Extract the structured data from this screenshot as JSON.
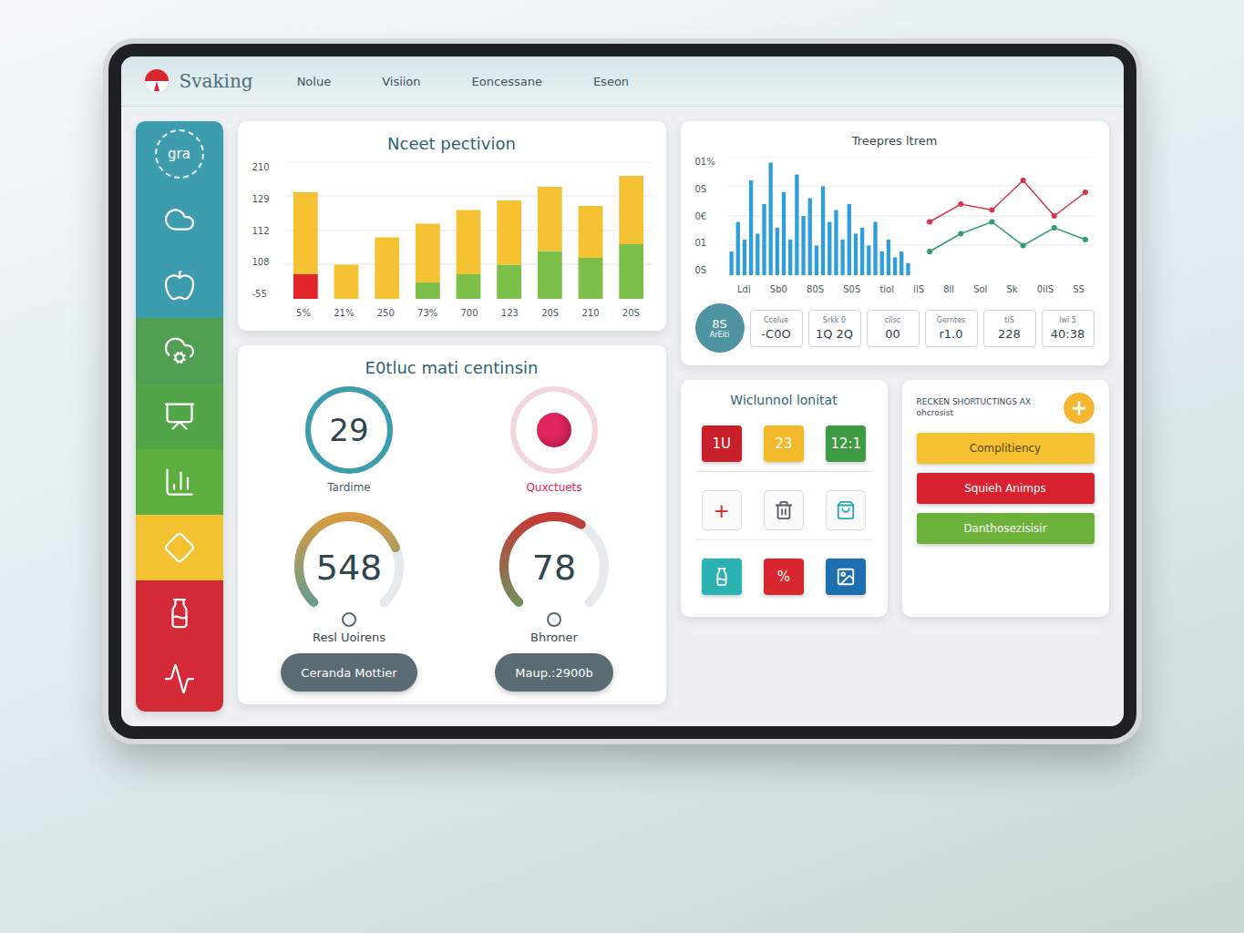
{
  "header": {
    "logo": "Svaking",
    "nav": [
      "Nolue",
      "Visiion",
      "Eoncessane",
      "Eseon"
    ]
  },
  "sidebar": {
    "items": [
      {
        "kind": "badge",
        "text": "gra",
        "color": "#3d9cad"
      },
      {
        "kind": "icon",
        "color": "#3d9cad"
      },
      {
        "kind": "icon",
        "color": "#3d9cad"
      },
      {
        "kind": "icon",
        "color": "#4f9e52"
      },
      {
        "kind": "icon",
        "color": "#52a548"
      },
      {
        "kind": "icon",
        "color": "#5cae3e"
      },
      {
        "kind": "icon",
        "color": "#f2c230"
      },
      {
        "kind": "icon",
        "color": "#d42a37"
      },
      {
        "kind": "icon",
        "color": "#d42a37"
      }
    ]
  },
  "bar_chart": {
    "title": "Nceet pectivion",
    "y_ticks": [
      "210",
      "129",
      "112",
      "108",
      "-55"
    ],
    "x_labels": [
      "5%",
      "21%",
      "250",
      "73%",
      "700",
      "123",
      "20S",
      "210",
      "20S"
    ],
    "max": 100,
    "series": [
      {
        "color": "#e2262c",
        "values": [
          18,
          0,
          0,
          0,
          0,
          0,
          0,
          0,
          0
        ]
      },
      {
        "color": "#7cc04a",
        "values": [
          0,
          0,
          0,
          12,
          18,
          25,
          35,
          30,
          40
        ]
      },
      {
        "color": "#f4c233",
        "values": [
          60,
          25,
          45,
          43,
          47,
          47,
          47,
          38,
          50
        ]
      }
    ]
  },
  "line_chart": {
    "title": "Treepres ltrem",
    "y_ticks": [
      "01%",
      "0S",
      "0€",
      "01",
      "0S"
    ],
    "x_labels": [
      "Ldi",
      "Sb0",
      "80S",
      "S0S",
      "tiol",
      "ilS",
      "8ll",
      "Sol",
      "Sk",
      "0ilS",
      "SS"
    ],
    "max": 100,
    "spikes": {
      "color": "#2e9fd8",
      "values": [
        20,
        45,
        30,
        80,
        35,
        60,
        95,
        40,
        70,
        30,
        85,
        50,
        65,
        25,
        75,
        45,
        55,
        30,
        60,
        35,
        40,
        25,
        45,
        20,
        30,
        15,
        20,
        10
      ]
    },
    "lines": [
      {
        "color": "#d9344a",
        "values": [
          45,
          60,
          55,
          80,
          50,
          70
        ]
      },
      {
        "color": "#2e9e6a",
        "values": [
          20,
          35,
          45,
          25,
          40,
          30
        ]
      }
    ]
  },
  "stats": {
    "badge": "8S",
    "badge_caption": "ArEiti",
    "items": [
      {
        "value": "-C0O",
        "caption": "Ccelue"
      },
      {
        "value": "1Q 2Q",
        "caption": "Srkk 0"
      },
      {
        "value": "00",
        "caption": "cilsc"
      },
      {
        "value": "r1.0",
        "caption": "Gerntes"
      },
      {
        "value": "228",
        "caption": "tiS"
      },
      {
        "value": "40:38",
        "caption": "lwi 5"
      }
    ]
  },
  "status": {
    "title": "E0tluc mati centinsin",
    "rings": [
      {
        "kind": "number",
        "value": "29",
        "label": "Tardime",
        "color": "#3d9cad"
      },
      {
        "kind": "dot",
        "label": "Quxctuets",
        "color": "#e0245e"
      }
    ],
    "gauges": [
      {
        "value": "548",
        "label": "Resl Uoirens",
        "level": 0.75,
        "color": "#f29a2e",
        "color2": "#3d9cad"
      },
      {
        "value": "78",
        "label": "Bhroner",
        "level": 0.62,
        "color": "#d9262e",
        "color2": "#4fb06a"
      }
    ],
    "buttons": [
      "Ceranda Mottier",
      "Maup.:2900b"
    ]
  },
  "widgets": {
    "title": "Wiclunnol lonitat",
    "tiles": [
      {
        "text": "1U",
        "color": "#c8202a"
      },
      {
        "text": "23",
        "color": "#f2b92a"
      },
      {
        "text": "12:1",
        "color": "#3f9a44"
      }
    ],
    "actions": [
      {
        "kind": "text",
        "text": "+",
        "color": "#d9262e"
      },
      {
        "kind": "icon",
        "color": "#555e63"
      },
      {
        "kind": "icon",
        "color": "#2aa3b8"
      }
    ],
    "apps": [
      {
        "kind": "icon",
        "color": "#2bb3b1"
      },
      {
        "kind": "text",
        "text": "%",
        "color": "#d9262e"
      },
      {
        "kind": "icon",
        "color": "#1d6fb0"
      }
    ]
  },
  "shortcuts": {
    "title": "RECKEN SHORTUCTINGS AX ohcrosist",
    "items": [
      {
        "label": "Complitiency",
        "color": "#f5c232"
      },
      {
        "label": "Squieh Animps",
        "color": "#d9222f"
      },
      {
        "label": "Danthosezisisir",
        "color": "#6cb23a"
      }
    ]
  }
}
